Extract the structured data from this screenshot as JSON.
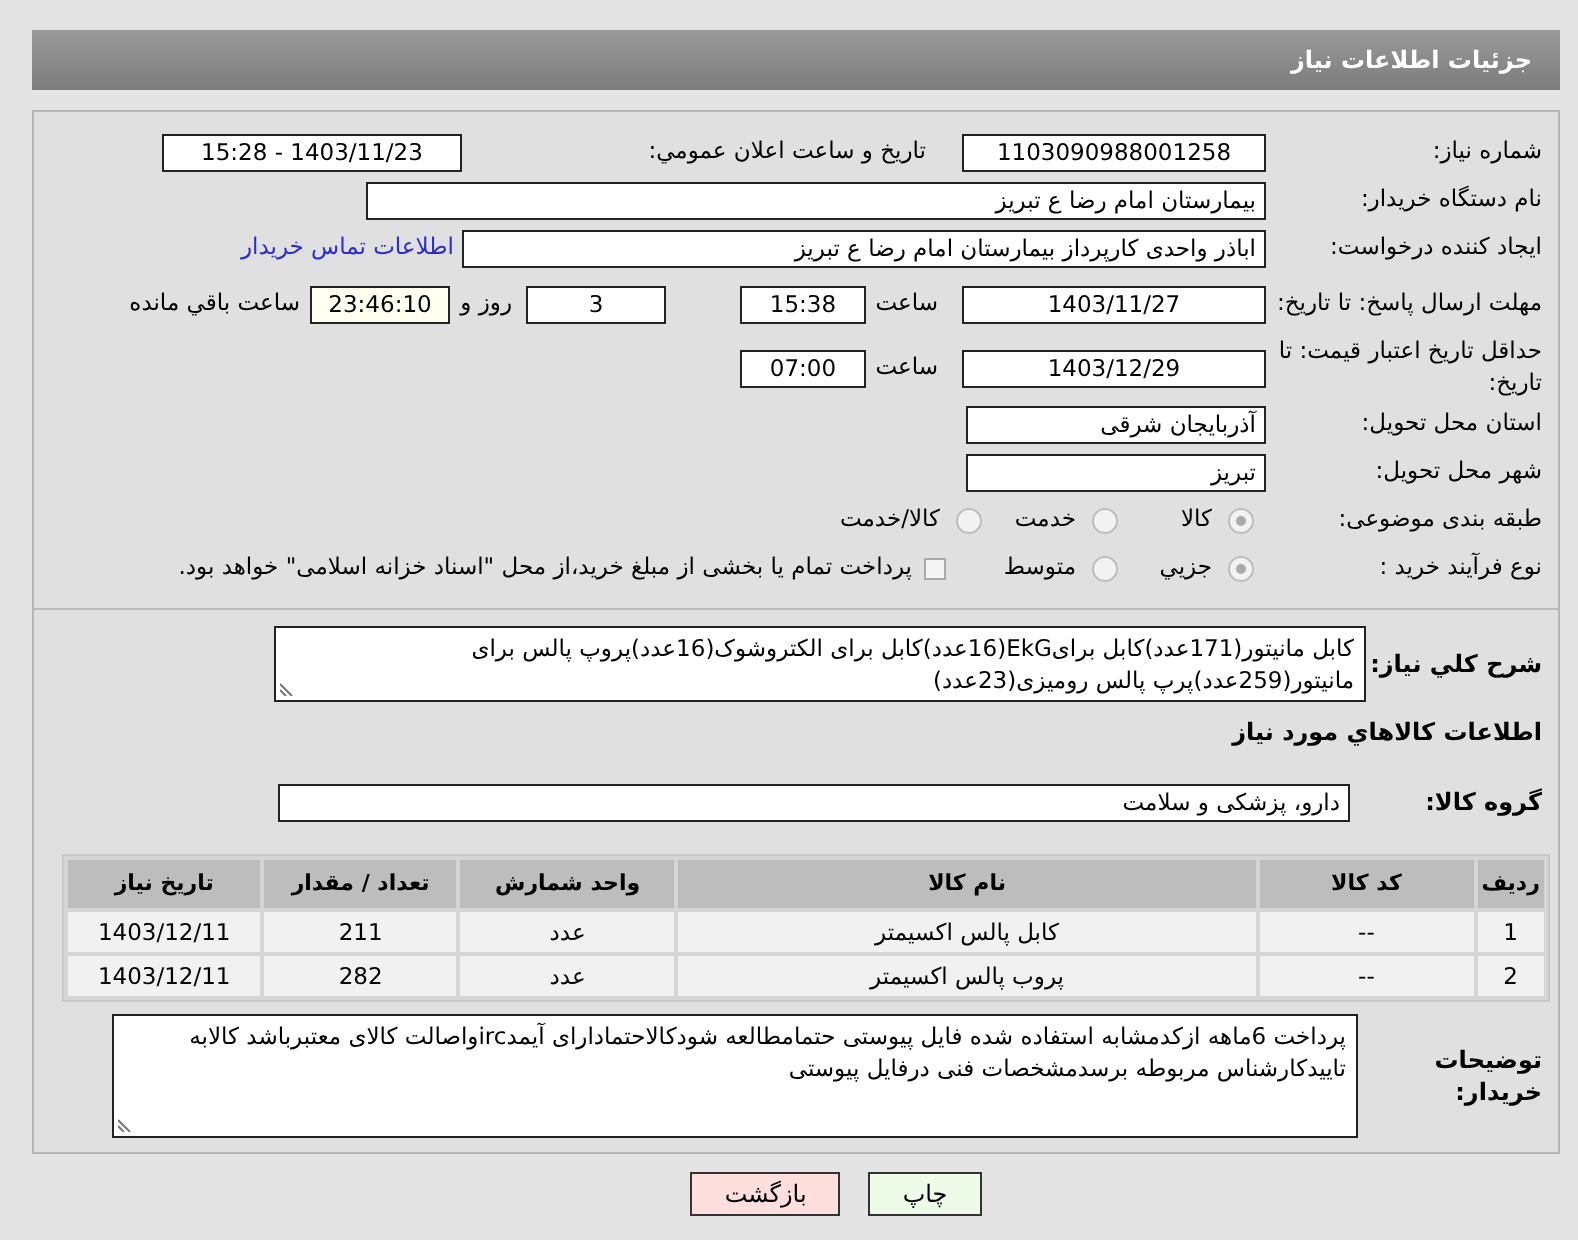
{
  "title": "جزئیات اطلاعات نیاز",
  "need_number": {
    "label": "شماره نیاز:",
    "value": "1103090988001258"
  },
  "announce": {
    "label": "تاریخ و ساعت اعلان عمومي:",
    "value": "1403/11/23 - 15:28"
  },
  "buyer": {
    "label": "نام دستگاه خریدار:",
    "value": "بیمارستان امام رضا  ع  تبریز"
  },
  "requester": {
    "label": "ایجاد کننده درخواست:",
    "value": "اباذر واحدی کارپرداز بیمارستان امام رضا  ع  تبریز",
    "link": "اطلاعات تماس خریدار"
  },
  "reply_deadline": {
    "label": "مهلت ارسال پاسخ: تا تاریخ:",
    "date": "1403/11/27",
    "time_label": "ساعت",
    "time": "15:38",
    "days": "3",
    "days_label": "روز و",
    "remaining": "23:46:10",
    "remaining_label": "ساعت باقي مانده"
  },
  "price_validity": {
    "label": "حداقل تاریخ اعتبار قیمت: تا تاریخ:",
    "date": "1403/12/29",
    "time_label": "ساعت",
    "time": "07:00"
  },
  "province": {
    "label": "استان محل تحویل:",
    "value": "آذربایجان شرقی"
  },
  "city": {
    "label": "شهر محل تحویل:",
    "value": "تبریز"
  },
  "category": {
    "label": "طبقه بندی موضوعی:",
    "options": [
      {
        "label": "کالا",
        "selected": true
      },
      {
        "label": "خدمت",
        "selected": false
      },
      {
        "label": "کالا/خدمت",
        "selected": false
      }
    ]
  },
  "process": {
    "label": "نوع فرآیند خرید :",
    "options": [
      {
        "label": "جزیي",
        "selected": true
      },
      {
        "label": "متوسط",
        "selected": false
      }
    ],
    "payment": {
      "label": "پرداخت تمام یا بخشی از مبلغ خرید،از محل \"اسناد خزانه اسلامی\" خواهد بود.",
      "checked": false
    }
  },
  "description": {
    "label": "شرح کلي نیاز:",
    "value": "کابل مانیتور(171عدد)کابل برایEkG(16عدد)کابل برای الکتروشوک(16عدد)پروپ پالس برای مانیتور(259عدد)پرپ پالس رومیزی(23عدد)"
  },
  "items_heading": "اطلاعات کالاهاي مورد نیاز",
  "group": {
    "label": "گروه کالا:",
    "value": "دارو، پزشکی و سلامت"
  },
  "table": {
    "columns": [
      "ردیف",
      "کد کالا",
      "نام کالا",
      "واحد شمارش",
      "تعداد / مقدار",
      "تاریخ نیاز"
    ],
    "rows": [
      [
        "1",
        "--",
        "کابل پالس اکسیمتر",
        "عدد",
        "211",
        "1403/12/11"
      ],
      [
        "2",
        "--",
        "پروب پالس اکسیمتر",
        "عدد",
        "282",
        "1403/12/11"
      ]
    ]
  },
  "buyer_notes": {
    "label": "توضیحات خریدار:",
    "value": "پرداخت 6ماهه ازکدمشابه استفاده شده فایل پیوستی حتمامطالعه شودکالاحتمادارای آیمدircواصالت کالای معتبرباشد کالابه تاییدکارشناس مربوطه برسدمشخصات فنی درفایل پیوستی"
  },
  "buttons": [
    {
      "label": "چاپ",
      "kind": "print"
    },
    {
      "label": "بازگشت",
      "kind": "back"
    }
  ]
}
